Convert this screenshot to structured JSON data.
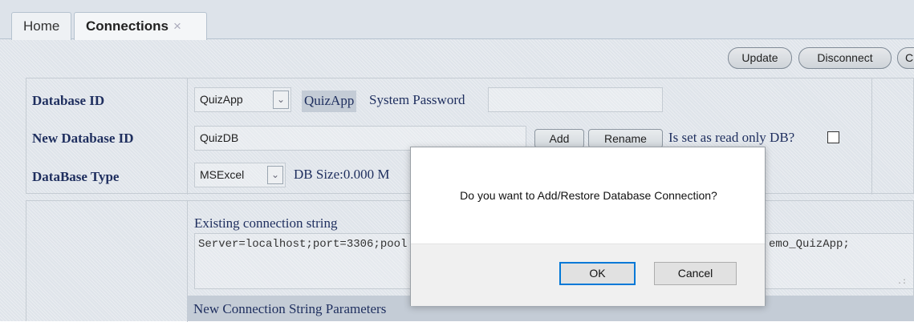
{
  "tabs": {
    "home": "Home",
    "connections": "Connections",
    "close_glyph": "×"
  },
  "toolbar": {
    "update": "Update",
    "disconnect": "Disconnect",
    "next_partial": "C"
  },
  "form": {
    "database_id_label": "Database ID",
    "database_id_value": "QuizApp",
    "database_id_badge": "QuizApp",
    "system_password_label": "System Password",
    "new_database_id_label": "New Database ID",
    "new_database_id_value": "QuizDB",
    "add_button": "Add",
    "rename_button": "Rename",
    "read_only_label": "Is set as read only DB?",
    "database_type_label": "DataBase Type",
    "database_type_value": "MSExcel",
    "db_size_text": "DB Size:0.000 M"
  },
  "connection": {
    "existing_label": "Existing connection string",
    "existing_left": "Server=localhost;port=3306;pool",
    "existing_right": "emo_QuizApp;",
    "new_params_label": "New Connection String Parameters"
  },
  "dialog": {
    "message": "Do you want to Add/Restore Database Connection?",
    "ok": "OK",
    "cancel": "Cancel"
  },
  "icons": {
    "dropdown": "chevron-down-icon",
    "close": "close-icon",
    "resize": "resize-grip-icon"
  }
}
